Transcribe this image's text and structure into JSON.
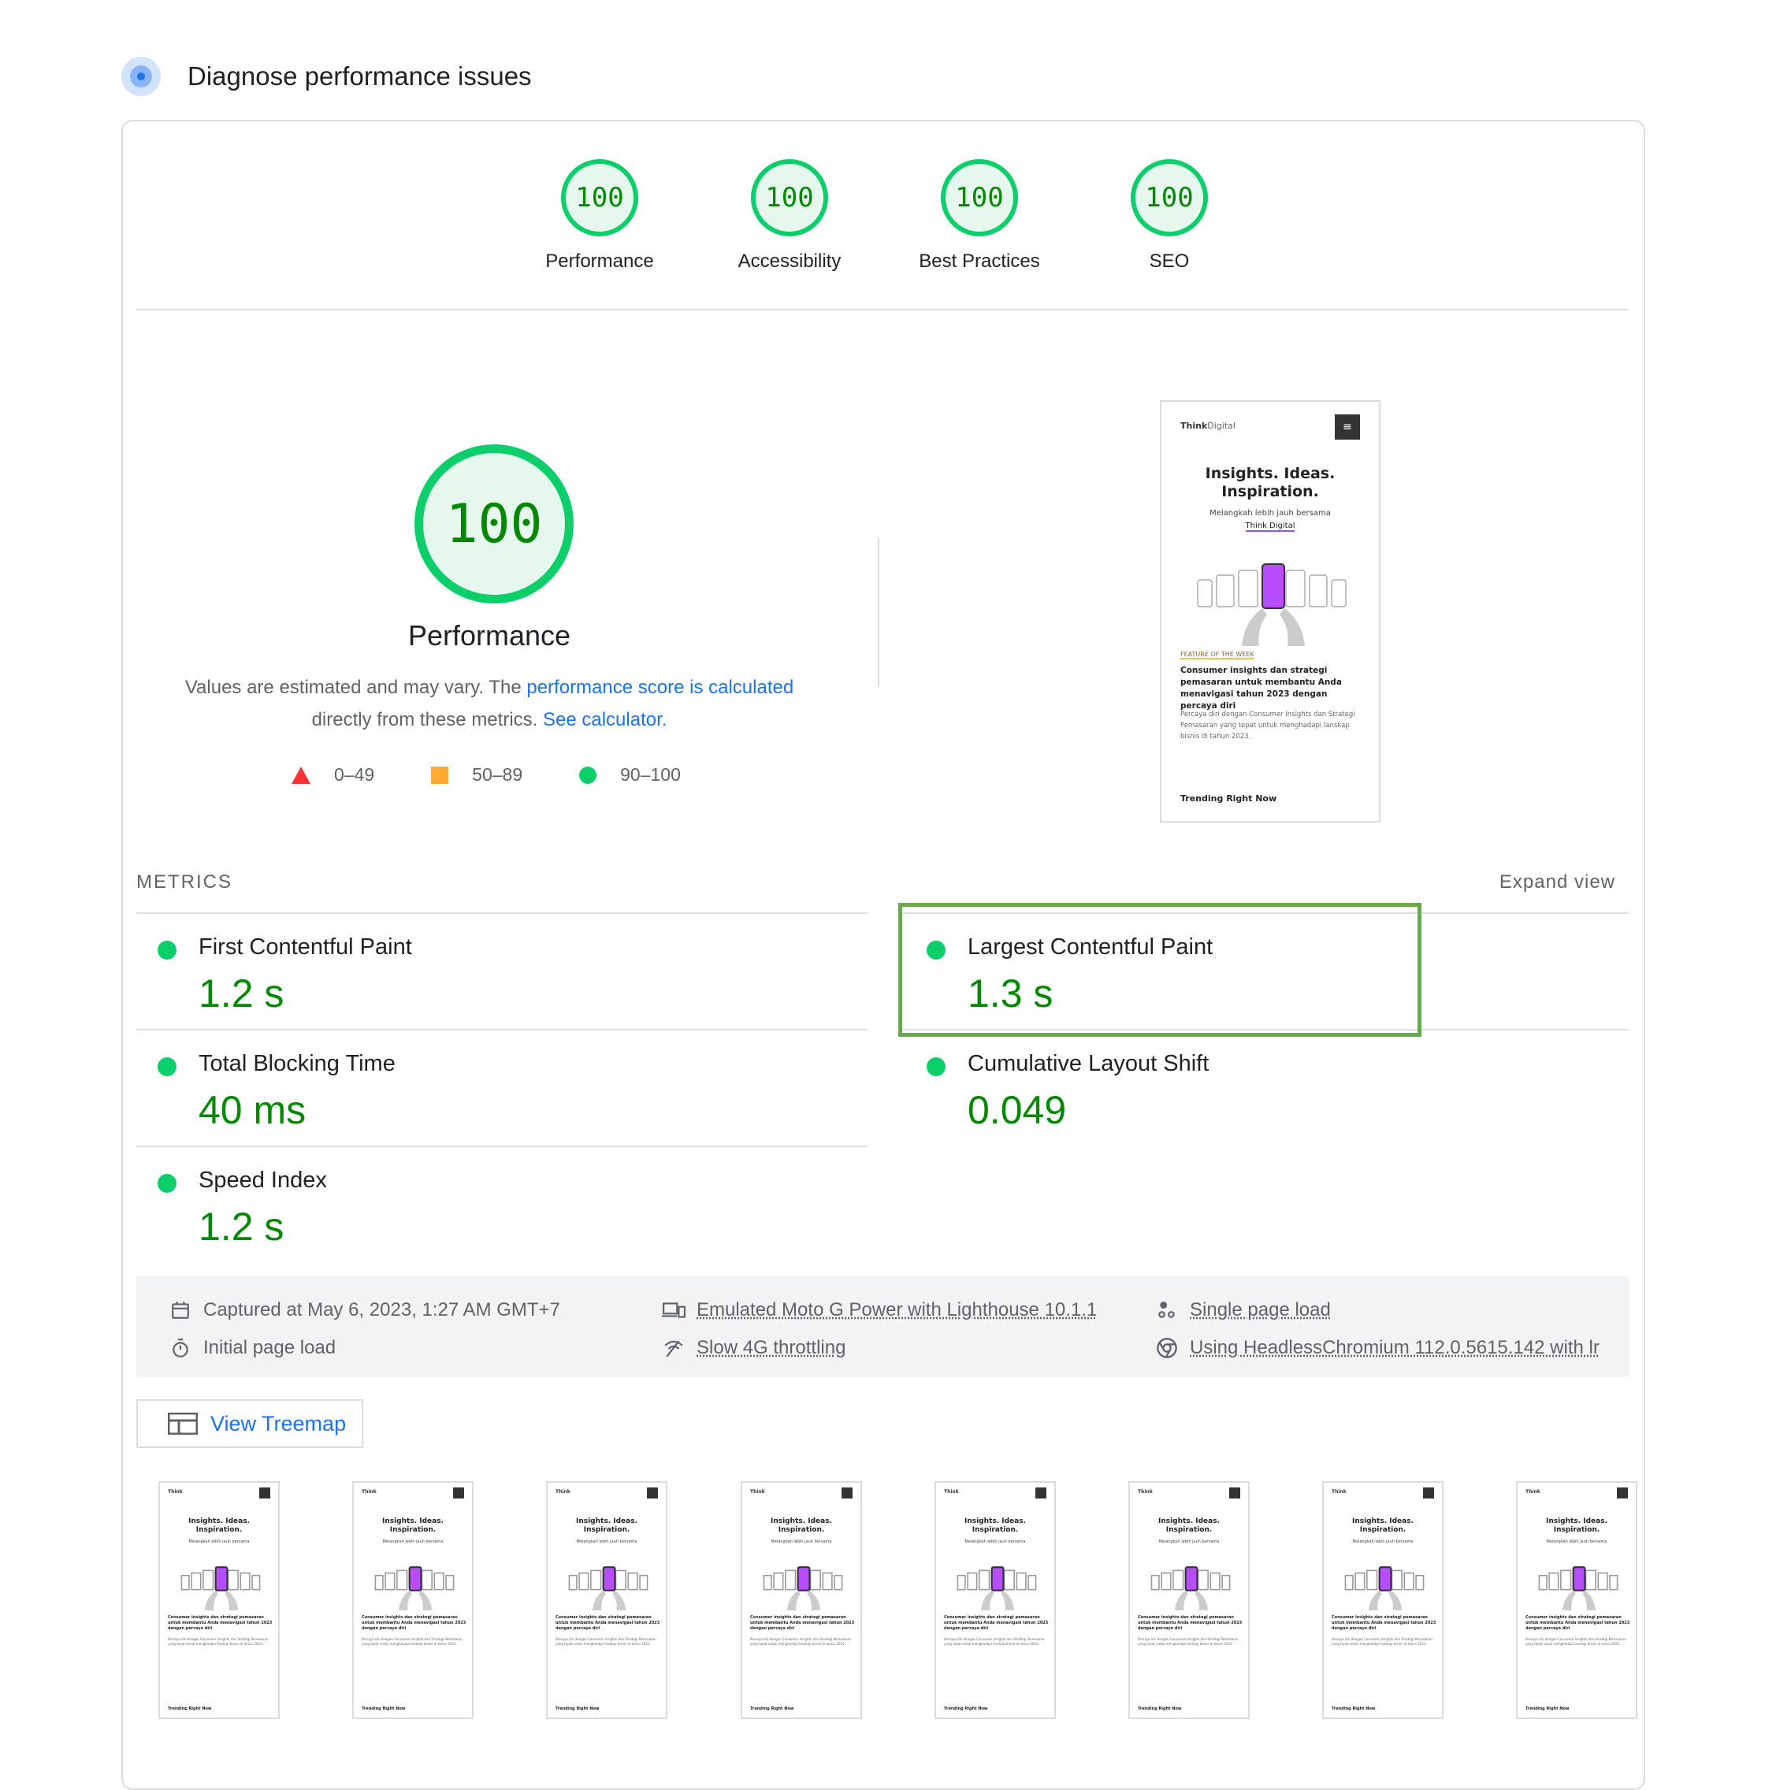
{
  "header": {
    "title": "Diagnose performance issues",
    "icon": "lighthouse-icon"
  },
  "categories": [
    {
      "score": "100",
      "label": "Performance"
    },
    {
      "score": "100",
      "label": "Accessibility"
    },
    {
      "score": "100",
      "label": "Best Practices"
    },
    {
      "score": "100",
      "label": "SEO"
    }
  ],
  "performance": {
    "score": "100",
    "title": "Performance",
    "desc_prefix": "Values are estimated and may vary. The ",
    "desc_link": "performance score is calculated",
    "desc_middle": " directly from these metrics. ",
    "desc_link2": "See calculator.",
    "legend": [
      {
        "range": "0–49",
        "color": "#ff3333"
      },
      {
        "range": "50–89",
        "color": "#ffaa33"
      },
      {
        "range": "90–100",
        "color": "#0cce6b"
      }
    ]
  },
  "screenshot": {
    "brand_bold": "Think",
    "brand_rest": "Digital",
    "headline_1": "Insights. Ideas.",
    "headline_2": "Inspiration.",
    "sub": "Melangkah lebih jauh bersama",
    "sub_link": "Think Digital",
    "feature_tag": "FEATURE OF THE WEEK",
    "feature_title": "Consumer insights dan strategi pemasaran untuk membantu Anda menavigasi tahun 2023 dengan percaya diri",
    "feature_body": "Percaya diri dengan Consumer Insights dan Strategi Pemasaran yang tepat untuk menghadapi lanskap bisnis di tahun 2023.",
    "trending": "Trending Right Now"
  },
  "metrics": {
    "label": "METRICS",
    "expand": "Expand view",
    "items": [
      {
        "name": "First Contentful Paint",
        "value": "1.2 s"
      },
      {
        "name": "Largest Contentful Paint",
        "value": "1.3 s"
      },
      {
        "name": "Total Blocking Time",
        "value": "40 ms"
      },
      {
        "name": "Cumulative Layout Shift",
        "value": "0.049"
      },
      {
        "name": "Speed Index",
        "value": "1.2 s"
      }
    ]
  },
  "runtime": {
    "captured": "Captured at May 6, 2023, 1:27 AM GMT+7",
    "initial": "Initial page load",
    "device": "Emulated Moto G Power with Lighthouse 10.1.1",
    "throttling": "Slow 4G throttling",
    "session": "Single page load",
    "browser": "Using HeadlessChromium 112.0.5615.142 with lr"
  },
  "treemap": {
    "label": "View Treemap"
  },
  "colors": {
    "pass": "#0cce6b",
    "pass_text": "#008800",
    "link": "#1a73e8",
    "highlight": "#6aa84f"
  }
}
